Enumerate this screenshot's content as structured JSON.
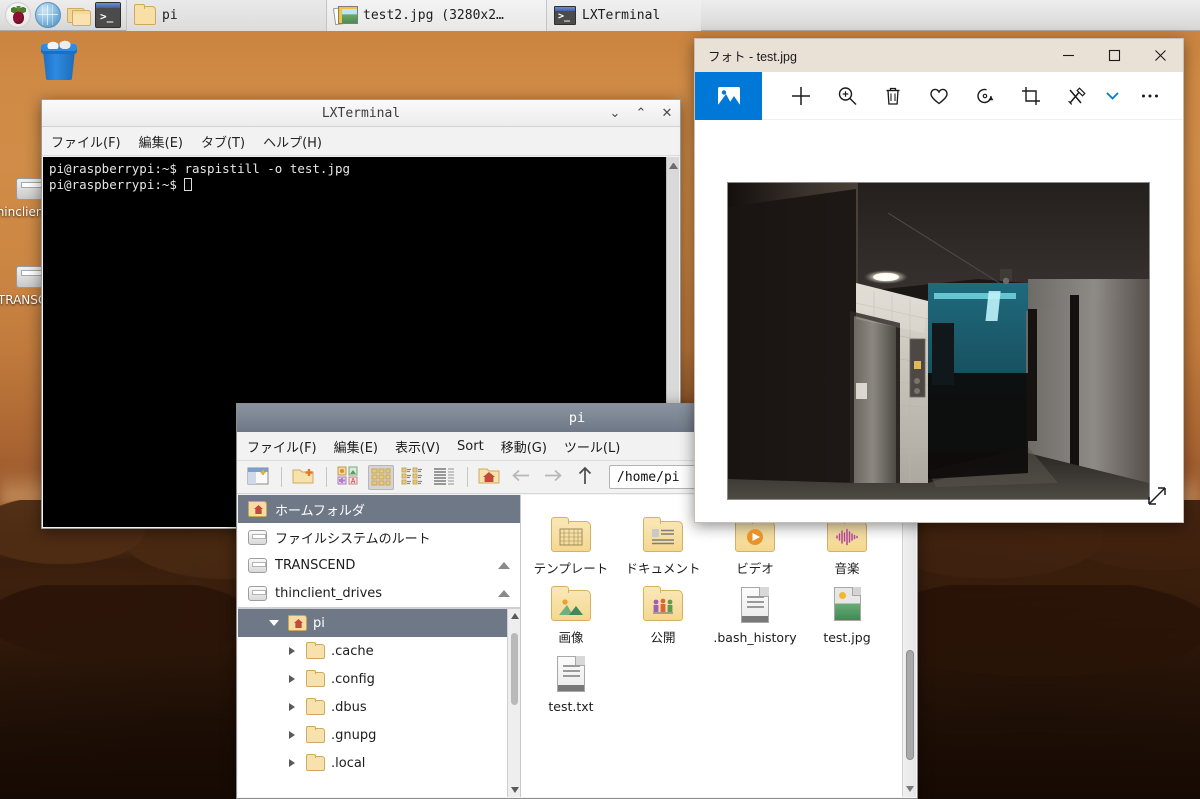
{
  "desktop": {
    "icons": [
      {
        "name": "trash",
        "label": ""
      },
      {
        "name": "thinclient_drives",
        "label": "thinclient_drives"
      },
      {
        "name": "TRANSCEND",
        "label": "TRANSCEND"
      }
    ]
  },
  "taskbar": {
    "launchers": [
      {
        "name": "raspberry-menu",
        "title": "Menu"
      },
      {
        "name": "web-browser",
        "title": "Web Browser"
      },
      {
        "name": "file-manager",
        "title": "File Manager"
      },
      {
        "name": "terminal",
        "title": "Terminal"
      }
    ],
    "tasks": [
      {
        "name": "task-file-manager",
        "label": "pi",
        "icon": "folder-icon"
      },
      {
        "name": "task-photos",
        "label": "test2.jpg (3280x2…",
        "icon": "photo-icon"
      },
      {
        "name": "task-terminal",
        "label": "LXTerminal",
        "icon": "terminal-icon"
      }
    ]
  },
  "terminal": {
    "title": "LXTerminal",
    "menu": [
      "ファイル(F)",
      "編集(E)",
      "タブ(T)",
      "ヘルプ(H)"
    ],
    "window_buttons": {
      "minimize": "⌄",
      "maximize": "⌃",
      "close": "✕"
    },
    "lines": [
      "pi@raspberrypi:~$ raspistill -o test.jpg",
      "pi@raspberrypi:~$ "
    ]
  },
  "filemanager": {
    "title": "pi",
    "menu": [
      "ファイル(F)",
      "編集(E)",
      "表示(V)",
      "Sort",
      "移動(G)",
      "ツール(L)"
    ],
    "path": "/home/pi",
    "toolbar": [
      {
        "name": "new-tab-button"
      },
      {
        "name": "new-folder-button"
      },
      {
        "name": "view-thumbnail-button"
      },
      {
        "name": "view-icon-button"
      },
      {
        "name": "view-compact-button"
      },
      {
        "name": "view-detail-button"
      },
      {
        "name": "home-button"
      },
      {
        "name": "back-button"
      },
      {
        "name": "forward-button"
      },
      {
        "name": "up-button"
      }
    ],
    "places": [
      {
        "label": "ホームフォルダ",
        "icon": "home-icon",
        "selected": true,
        "eject": false
      },
      {
        "label": "ファイルシステムのルート",
        "icon": "drive-icon",
        "selected": false,
        "eject": false
      },
      {
        "label": "TRANSCEND",
        "icon": "drive-icon",
        "selected": false,
        "eject": true
      },
      {
        "label": "thinclient_drives",
        "icon": "drive-icon",
        "selected": false,
        "eject": true
      }
    ],
    "tree": [
      {
        "label": "pi",
        "icon": "home-icon",
        "expanded": true,
        "selected": true,
        "indent": 1
      },
      {
        "label": ".cache",
        "icon": "folder-icon",
        "expanded": false,
        "selected": false,
        "indent": 2
      },
      {
        "label": ".config",
        "icon": "folder-icon",
        "expanded": false,
        "selected": false,
        "indent": 2
      },
      {
        "label": ".dbus",
        "icon": "folder-icon",
        "expanded": false,
        "selected": false,
        "indent": 2
      },
      {
        "label": ".gnupg",
        "icon": "folder-icon",
        "expanded": false,
        "selected": false,
        "indent": 2
      },
      {
        "label": ".local",
        "icon": "folder-icon",
        "expanded": false,
        "selected": false,
        "indent": 2
      }
    ],
    "cut_off_row": [
      "",
      ""
    ],
    "files": [
      {
        "name": "テンプレート",
        "type": "folder",
        "deco": "template"
      },
      {
        "name": "ドキュメント",
        "type": "folder",
        "deco": "document"
      },
      {
        "name": "ビデオ",
        "type": "folder",
        "deco": "video"
      },
      {
        "name": "音楽",
        "type": "folder",
        "deco": "music"
      },
      {
        "name": "画像",
        "type": "folder",
        "deco": "picture"
      },
      {
        "name": "公開",
        "type": "folder",
        "deco": "public"
      },
      {
        "name": ".bash_history",
        "type": "document",
        "deco": ""
      },
      {
        "name": "test.jpg",
        "type": "image",
        "deco": ""
      },
      {
        "name": "test.txt",
        "type": "document",
        "deco": ""
      }
    ]
  },
  "photos": {
    "title": "フォト - test.jpg",
    "window_buttons": {
      "minimize": "─",
      "maximize": "☐",
      "close": "✕"
    },
    "toolbar": [
      {
        "name": "collection-button",
        "icon": "photo-icon",
        "active": true
      },
      {
        "name": "add-button",
        "icon": "plus-icon"
      },
      {
        "name": "zoom-button",
        "icon": "zoom-in-icon"
      },
      {
        "name": "delete-button",
        "icon": "trash-icon"
      },
      {
        "name": "favorite-button",
        "icon": "heart-icon"
      },
      {
        "name": "rotate-button",
        "icon": "rotate-icon"
      },
      {
        "name": "crop-button",
        "icon": "crop-icon"
      },
      {
        "name": "edit-button",
        "icon": "magic-wand-icon"
      },
      {
        "name": "edit-dropdown-button",
        "icon": "chevron-down-icon"
      },
      {
        "name": "more-button",
        "icon": "ellipsis-icon"
      }
    ],
    "image_alt": "test.jpg",
    "resize_handle": "resize-icon",
    "accent_color": "#0078d7"
  }
}
